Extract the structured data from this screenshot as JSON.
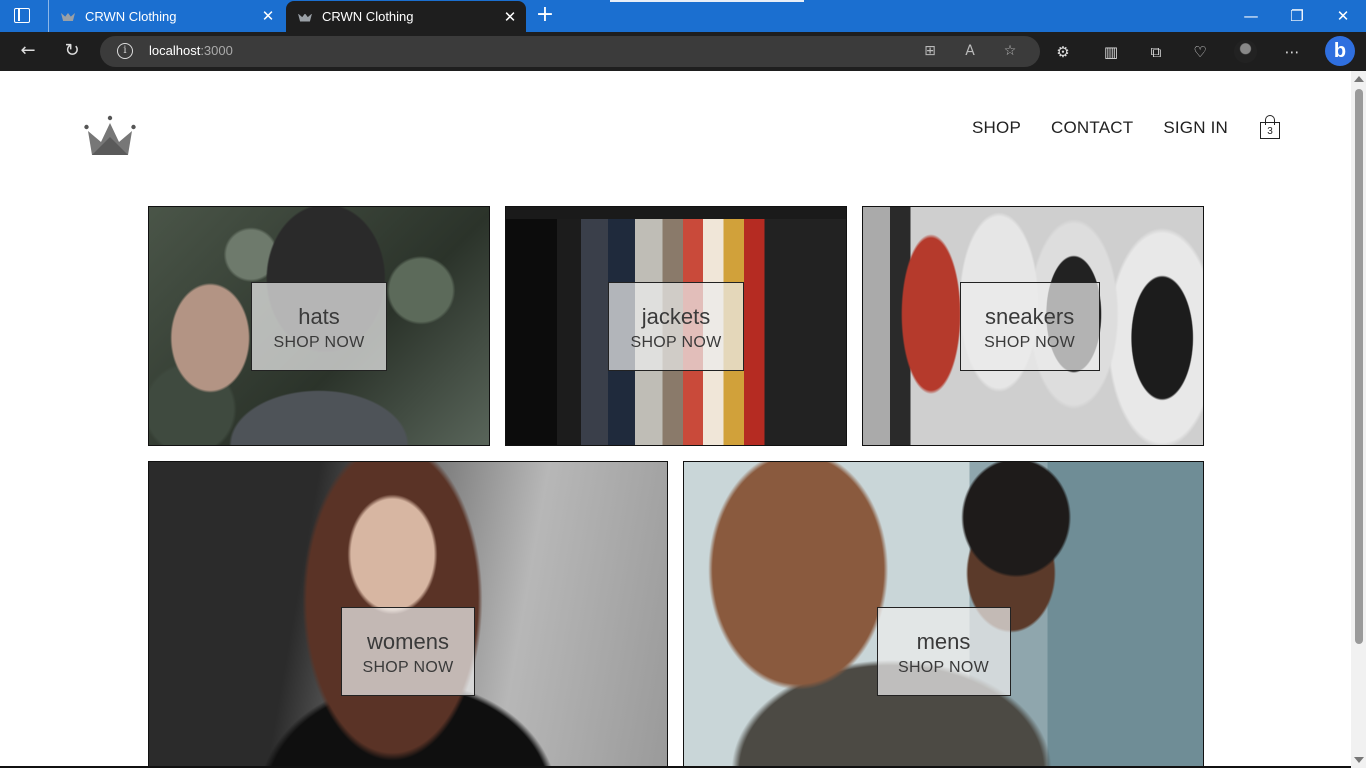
{
  "browser": {
    "tabs": [
      {
        "title": "CRWN Clothing",
        "active": false
      },
      {
        "title": "CRWN Clothing",
        "active": true
      }
    ],
    "url": {
      "host": "localhost",
      "port": ":3000"
    }
  },
  "header": {
    "nav": {
      "shop": "SHOP",
      "contact": "CONTACT",
      "sign_in": "SIGN IN"
    },
    "cart_count": "3"
  },
  "categories": [
    {
      "title": "hats",
      "cta": "SHOP NOW"
    },
    {
      "title": "jackets",
      "cta": "SHOP NOW"
    },
    {
      "title": "sneakers",
      "cta": "SHOP NOW"
    },
    {
      "title": "womens",
      "cta": "SHOP NOW"
    },
    {
      "title": "mens",
      "cta": "SHOP NOW"
    }
  ]
}
